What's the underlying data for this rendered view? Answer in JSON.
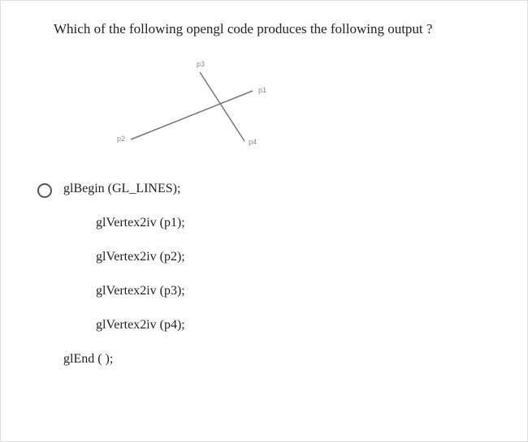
{
  "question": "Which of the following opengl code produces the following output ?",
  "diagram": {
    "labels": {
      "p1": "p1",
      "p2": "p2",
      "p3": "p3",
      "p4": "p4"
    }
  },
  "option": {
    "lines": [
      "glBegin (GL_LINES);",
      "glVertex2iv (p1);",
      "glVertex2iv (p2);",
      "glVertex2iv (p3);",
      "glVertex2iv (p4);",
      "glEnd ( );"
    ]
  }
}
